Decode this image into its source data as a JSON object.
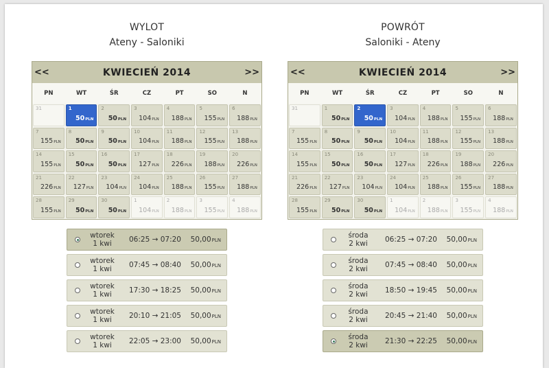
{
  "outbound": {
    "title": "WYLOT",
    "route": "Ateny - Saloniki",
    "calendar": {
      "month": "KWIECIEŃ 2014",
      "prev": "<<",
      "next": ">>",
      "days": [
        "PN",
        "WT",
        "ŚR",
        "CZ",
        "PT",
        "SO",
        "N"
      ],
      "cells": [
        {
          "d": "31",
          "p": "",
          "other": true
        },
        {
          "d": "1",
          "p": "50",
          "sel": true
        },
        {
          "d": "2",
          "p": "50",
          "bold": true
        },
        {
          "d": "3",
          "p": "104"
        },
        {
          "d": "4",
          "p": "188"
        },
        {
          "d": "5",
          "p": "155"
        },
        {
          "d": "6",
          "p": "188"
        },
        {
          "d": "7",
          "p": "155"
        },
        {
          "d": "8",
          "p": "50",
          "bold": true
        },
        {
          "d": "9",
          "p": "50",
          "bold": true
        },
        {
          "d": "10",
          "p": "104"
        },
        {
          "d": "11",
          "p": "188"
        },
        {
          "d": "12",
          "p": "155"
        },
        {
          "d": "13",
          "p": "188"
        },
        {
          "d": "14",
          "p": "155"
        },
        {
          "d": "15",
          "p": "50",
          "bold": true
        },
        {
          "d": "16",
          "p": "50",
          "bold": true
        },
        {
          "d": "17",
          "p": "127"
        },
        {
          "d": "18",
          "p": "226"
        },
        {
          "d": "19",
          "p": "188"
        },
        {
          "d": "20",
          "p": "226"
        },
        {
          "d": "21",
          "p": "226"
        },
        {
          "d": "22",
          "p": "127"
        },
        {
          "d": "23",
          "p": "104"
        },
        {
          "d": "24",
          "p": "104"
        },
        {
          "d": "25",
          "p": "188"
        },
        {
          "d": "26",
          "p": "155"
        },
        {
          "d": "27",
          "p": "188"
        },
        {
          "d": "28",
          "p": "155"
        },
        {
          "d": "29",
          "p": "50",
          "bold": true
        },
        {
          "d": "30",
          "p": "50",
          "bold": true
        },
        {
          "d": "1",
          "p": "104",
          "other": true
        },
        {
          "d": "2",
          "p": "188",
          "other": true
        },
        {
          "d": "3",
          "p": "155",
          "other": true
        },
        {
          "d": "4",
          "p": "188",
          "other": true
        }
      ]
    },
    "currency": "PLN",
    "flights": [
      {
        "day": "wtorek",
        "date": "1 kwi",
        "time": "06:25 → 07:20",
        "price": "50,00",
        "sel": true
      },
      {
        "day": "wtorek",
        "date": "1 kwi",
        "time": "07:45 → 08:40",
        "price": "50,00"
      },
      {
        "day": "wtorek",
        "date": "1 kwi",
        "time": "17:30 → 18:25",
        "price": "50,00"
      },
      {
        "day": "wtorek",
        "date": "1 kwi",
        "time": "20:10 → 21:05",
        "price": "50,00"
      },
      {
        "day": "wtorek",
        "date": "1 kwi",
        "time": "22:05 → 23:00",
        "price": "50,00"
      }
    ]
  },
  "return": {
    "title": "POWRÓT",
    "route": "Saloniki - Ateny",
    "calendar": {
      "month": "KWIECIEŃ 2014",
      "prev": "<<",
      "next": ">>",
      "days": [
        "PN",
        "WT",
        "ŚR",
        "CZ",
        "PT",
        "SO",
        "N"
      ],
      "cells": [
        {
          "d": "31",
          "p": "",
          "other": true
        },
        {
          "d": "1",
          "p": "50",
          "bold": true
        },
        {
          "d": "2",
          "p": "50",
          "sel": true
        },
        {
          "d": "3",
          "p": "104"
        },
        {
          "d": "4",
          "p": "188"
        },
        {
          "d": "5",
          "p": "155"
        },
        {
          "d": "6",
          "p": "188"
        },
        {
          "d": "7",
          "p": "155"
        },
        {
          "d": "8",
          "p": "50",
          "bold": true
        },
        {
          "d": "9",
          "p": "50",
          "bold": true
        },
        {
          "d": "10",
          "p": "104"
        },
        {
          "d": "11",
          "p": "188"
        },
        {
          "d": "12",
          "p": "155"
        },
        {
          "d": "13",
          "p": "188"
        },
        {
          "d": "14",
          "p": "155"
        },
        {
          "d": "15",
          "p": "50",
          "bold": true
        },
        {
          "d": "16",
          "p": "50",
          "bold": true
        },
        {
          "d": "17",
          "p": "127"
        },
        {
          "d": "18",
          "p": "226"
        },
        {
          "d": "19",
          "p": "188"
        },
        {
          "d": "20",
          "p": "226"
        },
        {
          "d": "21",
          "p": "226"
        },
        {
          "d": "22",
          "p": "127"
        },
        {
          "d": "23",
          "p": "104"
        },
        {
          "d": "24",
          "p": "104"
        },
        {
          "d": "25",
          "p": "188"
        },
        {
          "d": "26",
          "p": "155"
        },
        {
          "d": "27",
          "p": "188"
        },
        {
          "d": "28",
          "p": "155"
        },
        {
          "d": "29",
          "p": "50",
          "bold": true
        },
        {
          "d": "30",
          "p": "50",
          "bold": true
        },
        {
          "d": "1",
          "p": "104",
          "other": true
        },
        {
          "d": "2",
          "p": "188",
          "other": true
        },
        {
          "d": "3",
          "p": "155",
          "other": true
        },
        {
          "d": "4",
          "p": "188",
          "other": true
        }
      ]
    },
    "currency": "PLN",
    "flights": [
      {
        "day": "środa",
        "date": "2 kwi",
        "time": "06:25 → 07:20",
        "price": "50,00"
      },
      {
        "day": "środa",
        "date": "2 kwi",
        "time": "07:45 → 08:40",
        "price": "50,00"
      },
      {
        "day": "środa",
        "date": "2 kwi",
        "time": "18:50 → 19:45",
        "price": "50,00"
      },
      {
        "day": "środa",
        "date": "2 kwi",
        "time": "20:45 → 21:40",
        "price": "50,00"
      },
      {
        "day": "środa",
        "date": "2 kwi",
        "time": "21:30 → 22:25",
        "price": "50,00",
        "sel": true
      }
    ]
  }
}
